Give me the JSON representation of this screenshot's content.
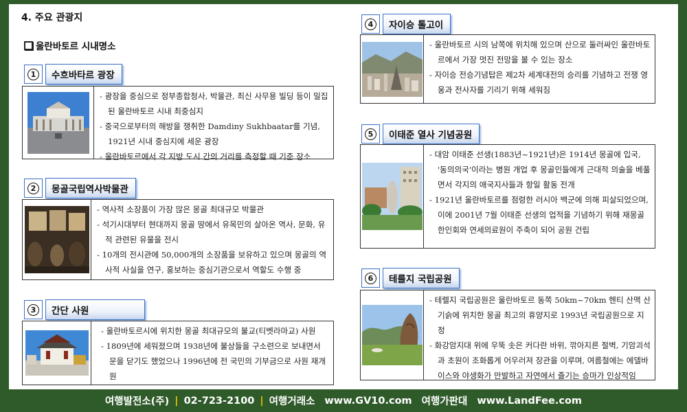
{
  "heading": "4. 주요 관광지",
  "subheading": "울란바토르 시내명소",
  "sections": [
    {
      "num": "1",
      "title": "수흐바타르 광장",
      "items": [
        "- 광장을 중심으로 정부종합청사, 박물관, 최신 사무용 빌딩 등이 밀집된 울란바토르 시내 최중심지",
        "- 중국으로부터의 해방을 쟁취한 Damdiny Sukhbaatar를 기념, 1921년 시내 중심지에 세운 광장",
        "- 울란바토르에서 각 지방 도시 간의 거리를 측정할 때 기준 장소"
      ]
    },
    {
      "num": "2",
      "title": "몽골국립역사박물관",
      "items": [
        "- 역사적 소장품이 가장 많은 몽골 최대규모 박물관",
        "- 석기시대부터 현대까지 몽골 땅에서 유목민의 살아온 역사, 문화, 유적 관련된 유물을 전시",
        "- 10개의 전시관에 50,000개의 소장품을 보유하고 있으며 몽골의 역사적 사실을 연구, 홍보하는 중심기관으로서 역할도 수행 중"
      ]
    },
    {
      "num": "3",
      "title": "간단 사원",
      "items": [
        "- 울란바토르시에 위치한 몽골 최대규모의 불교(티벳라마교) 사원",
        "- 1809년에 세워졌으며 1938년에 불상들을 구소련으로 보내면서 문을 닫기도 했었으나 1996년에 전 국민의 기부금으로 사원 재개원"
      ]
    },
    {
      "num": "4",
      "title": "자이승 톨고이",
      "items": [
        "- 울란바토르 시의 남쪽에 위치해 있으며 산으로 둘러싸인 울란바토르에서 가장 멋진 전망을 볼 수 있는 장소",
        "- 자이승 전승기념탑은 제2차 세계대전의 승리를 기념하고 전쟁 영웅과 전사자를 기리기 위해 세워짐"
      ]
    },
    {
      "num": "5",
      "title": "이태준 열사 기념공원",
      "items": [
        "- 대암 이태준 선생(1883년~1921년)은 1914년 몽골에 입국, '동의의국'이라는 병원 개업 후 몽골인들에게 근대적 의술을 베풀면서 각지의 애국지사들과 항일 활동 전개",
        "- 1921년 울란바토르를 점령한 러시아 백군에 의해 피살되었으며, 이에 2001년 7월 이태준 선생의 업적을 기념하기 위해 재몽골한인회와 연세의료원이 주축이 되어 공원 건립"
      ]
    },
    {
      "num": "6",
      "title": "테를지 국립공원",
      "items": [
        "- 테렐지 국립공원은 울란바토르 동쪽 50km~70km 헨티 산맥 산기슭에 위치한 몽골 최고의 휴양지로 1993년 국립공원으로 지정",
        "- 화강암지대 위에 우뚝 솟은 커다란 바위, 깎아지른 절벽, 기암괴석과 초원이 조화롭게 어우러져 장관을 이루며, 여름철에는 에델바이스와 야생화가 만발하고 자연에서 즐기는 승마가 인상적임"
      ]
    }
  ],
  "footer": {
    "company": "여행발전소(주)",
    "phone": "02-723-2100",
    "site1_label": "여행거래소",
    "site1_url": "www.GV10.com",
    "site2_label": "여행가판대",
    "site2_url": "www.LandFee.com",
    "separator": "|"
  }
}
